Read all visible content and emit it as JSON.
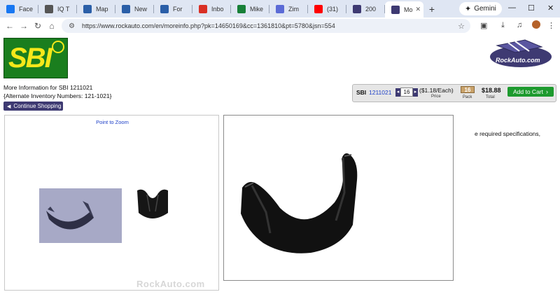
{
  "browser": {
    "tabs": [
      {
        "label": "Face",
        "icon": "facebook-icon",
        "color": "#1877f2"
      },
      {
        "label": "IQ T",
        "icon": "chat-icon",
        "color": "#555555"
      },
      {
        "label": "Map",
        "icon": "page-icon",
        "color": "#2b5fa8"
      },
      {
        "label": "New",
        "icon": "page-icon",
        "color": "#2b5fa8"
      },
      {
        "label": "For",
        "icon": "page-icon",
        "color": "#2b5fa8"
      },
      {
        "label": "Inbo",
        "icon": "gmail-icon",
        "color": "#d93025"
      },
      {
        "label": "Mike",
        "icon": "sheets-icon",
        "color": "#188038"
      },
      {
        "label": "Zim",
        "icon": "zim-icon",
        "color": "#5b6bd6"
      },
      {
        "label": "(31)",
        "icon": "youtube-icon",
        "color": "#ff0000"
      },
      {
        "label": "200",
        "icon": "rockauto-icon",
        "color": "#3e3a72"
      },
      {
        "label": "Mo",
        "icon": "rockauto-icon",
        "color": "#3e3a72",
        "active": true
      }
    ],
    "new_tab": "+",
    "gemini_label": "Gemini",
    "url": "https://www.rockauto.com/en/moreinfo.php?pk=14650169&cc=1361810&pt=5780&jsn=554"
  },
  "product": {
    "title": "More Information for SBI 1211021",
    "alt_inventory": "{Alternate Inventory Numbers: 121-1021}",
    "continue_label": "Continue Shopping"
  },
  "pricing": {
    "brand": "SBI",
    "part_number": "1211021",
    "quantity": "16",
    "each_price": "($1.18/Each)",
    "price_label": "Price",
    "pack_value": "16",
    "pack_label": "Pack",
    "total": "$18.88",
    "total_label": "Total",
    "add_to_cart": "Add to Cart"
  },
  "gallery": {
    "zoom_hint": "Point to Zoom",
    "watermark": "RockAuto.com"
  },
  "description_fragment": "e required specifications,",
  "colors": {
    "accent": "#3e3a72",
    "link": "#2042c8",
    "cart_green": "#1d9a2e",
    "sbi_green": "#1a7e1e",
    "sbi_yellow": "#f6e81a"
  }
}
